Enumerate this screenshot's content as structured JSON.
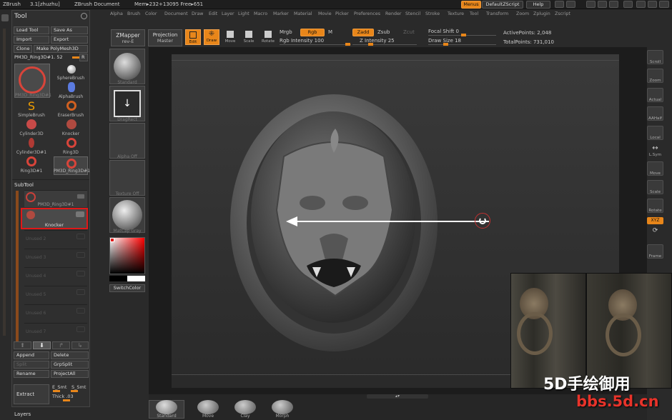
{
  "titlebar": {
    "app": "ZBrush",
    "version": "3.1[zhuzhu]",
    "doc": "ZBrush Document",
    "mem": "Mem▸232+13095 Free▸651"
  },
  "top_right": {
    "menus": "Menus",
    "script": "DefaultZScript",
    "help": "Help"
  },
  "menu_items": [
    "Alpha",
    "Brush",
    "Color",
    "Document",
    "Draw",
    "Edit",
    "Layer",
    "Light",
    "Macro",
    "Marker",
    "Material",
    "Movie",
    "Picker",
    "Preferences",
    "Render",
    "Stencil",
    "Stroke",
    "Texture",
    "Tool",
    "Transform",
    "Zoom",
    "Zplugin",
    "Zscript"
  ],
  "toolbar": {
    "zmapper": "ZMapper",
    "zmapper_sub": "rev-E",
    "projection": "Projection",
    "projection_sub": "Master",
    "edit": "Edit",
    "draw": "Draw",
    "move": "Move",
    "scale": "Scale",
    "rotate": "Rotate",
    "mrgb": "Mrgb",
    "rgb": "Rgb",
    "m": "M",
    "rgb_intensity": "Rgb Intensity 100",
    "zadd": "Zadd",
    "zsub": "Zsub",
    "zcut": "Zcut",
    "z_intensity": "Z Intensity 25",
    "focal_shift": "Focal Shift 0",
    "draw_size": "Draw Size 18",
    "active_points": "ActivePoints: 2,048",
    "total_points": "TotalPoints: 731,010"
  },
  "tool_panel": {
    "title": "Tool",
    "load_tool": "Load Tool",
    "save_as": "Save As",
    "import": "Import",
    "export": "Export",
    "clone": "Clone",
    "make_polymesh": "Make PolyMesh3D",
    "current_tool": "PM3D_Ring3D#1. 52",
    "r": "R",
    "current_tool_label": "PM3D_Ring3D#1",
    "tools": [
      "SphereBrush",
      "AlphaBrush",
      "SimpleBrush",
      "EraserBrush",
      "Cylinder3D",
      "Knocker",
      "Cylinder3D#1",
      "Ring3D",
      "Ring3D#1",
      "PM3D_Ring3D#1"
    ]
  },
  "subtool": {
    "title": "SubTool",
    "items": [
      "PM3D_Ring3D#1",
      "Knocker"
    ],
    "unused": [
      "Unused 2",
      "Unused 3",
      "Unused 4",
      "Unused 5",
      "Unused 6",
      "Unused 7"
    ],
    "append": "Append",
    "delete": "Delete",
    "split": "Split",
    "grpsplit": "GrpSplit",
    "rename": "Rename",
    "projectall": "ProjectAll",
    "extract": "Extract",
    "e_smt": "E_Smt",
    "s_smt": "S_Smt",
    "thick": "Thick .03"
  },
  "layers": "Layers",
  "brush_column": {
    "standard": "Standard",
    "dragrect": "DragRect",
    "alpha_off": "Alpha Off",
    "texture_off": "Texture Off",
    "matcap": "MatCap Gray",
    "switchcolor": "SwitchColor"
  },
  "right_shelf": [
    "Scroll",
    "Zoom",
    "Actual",
    "AAHalf",
    "Local",
    "L.Sym",
    "Move",
    "Scale",
    "Rotate",
    "XYZ",
    "Frame"
  ],
  "bottom_brushes": [
    "Standard",
    "Move",
    "Clay",
    "Morph"
  ],
  "watermark": {
    "line1": "5D手绘御用",
    "line2": "bbs.5d.cn"
  },
  "colors": {
    "accent": "#e8861a",
    "highlight_box": "#e01818"
  }
}
